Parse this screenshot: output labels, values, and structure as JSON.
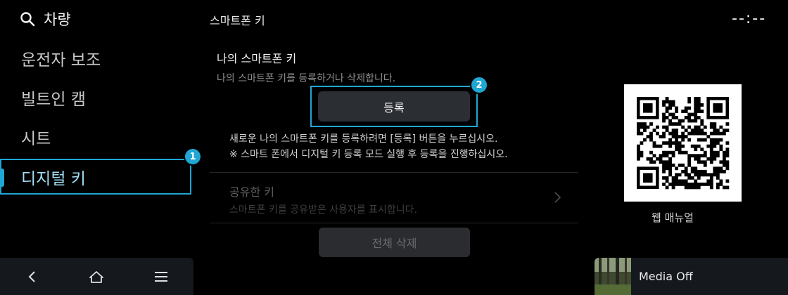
{
  "sidebar": {
    "search_label": "차량",
    "items": [
      {
        "label": "운전자 보조"
      },
      {
        "label": "빌트인 캠"
      },
      {
        "label": "시트"
      },
      {
        "label": "디지털 키"
      }
    ],
    "active_badge": "1"
  },
  "bottom_nav": {
    "back_icon": "back-chevron-icon",
    "home_icon": "home-icon",
    "menu_icon": "menu-icon"
  },
  "header": {
    "title": "스마트폰 키",
    "clock": "--:--"
  },
  "my_key": {
    "title": "나의 스마트폰 키",
    "description": "나의 스마트폰 키를 등록하거나 삭제합니다.",
    "register_label": "등록",
    "register_badge": "2",
    "info_line1": "새로운 나의 스마트폰 키를 등록하려면 [등록] 버튼을 누르십시오.",
    "info_line2": "※ 스마트 폰에서 디지털 키 등록 모드 실행 후 등록을 진행하십시오."
  },
  "shared_key": {
    "title": "공유한 키",
    "description": "스마트폰 키를 공유받은 사용자를 표시합니다."
  },
  "delete_all_label": "전체 삭제",
  "web_manual": {
    "label": "웹 매뉴얼"
  },
  "media": {
    "label": "Media Off"
  },
  "colors": {
    "accent": "#1fa6d3",
    "background": "#000000",
    "button": "#2b2e33"
  }
}
